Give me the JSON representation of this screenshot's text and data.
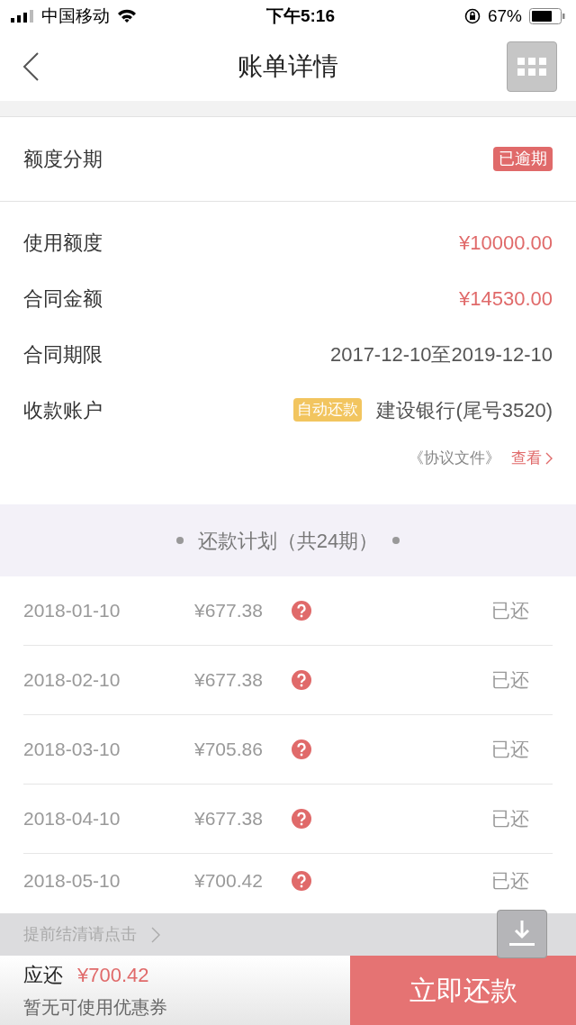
{
  "status_bar": {
    "carrier": "中国移动",
    "time": "下午5:16",
    "battery": "67%"
  },
  "nav": {
    "title": "账单详情"
  },
  "loan": {
    "type": "额度分期",
    "status_badge": "已逾期"
  },
  "details": [
    {
      "label": "使用额度",
      "value": "¥10000.00",
      "kind": "amount"
    },
    {
      "label": "合同金额",
      "value": "¥14530.00",
      "kind": "amount"
    },
    {
      "label": "合同期限",
      "value": "2017-12-10至2019-12-10",
      "kind": "text"
    },
    {
      "label": "收款账户",
      "value": "建设银行(尾号3520)",
      "tag": "自动还款",
      "kind": "account"
    }
  ],
  "agreement": {
    "text": "《协议文件》",
    "link": "查看"
  },
  "plan": {
    "title": "还款计划（共24期）",
    "rows": [
      {
        "date": "2018-01-10",
        "amount": "¥677.38",
        "status": "已还"
      },
      {
        "date": "2018-02-10",
        "amount": "¥677.38",
        "status": "已还"
      },
      {
        "date": "2018-03-10",
        "amount": "¥705.86",
        "status": "已还"
      },
      {
        "date": "2018-04-10",
        "amount": "¥677.38",
        "status": "已还"
      },
      {
        "date": "2018-05-10",
        "amount": "¥700.42",
        "status": "已还"
      }
    ]
  },
  "early_payoff": "提前结清请点击",
  "footer": {
    "due_label": "应还",
    "due_amount": "¥700.42",
    "coupon": "暂无可使用优惠券",
    "pay_button": "立即还款"
  }
}
